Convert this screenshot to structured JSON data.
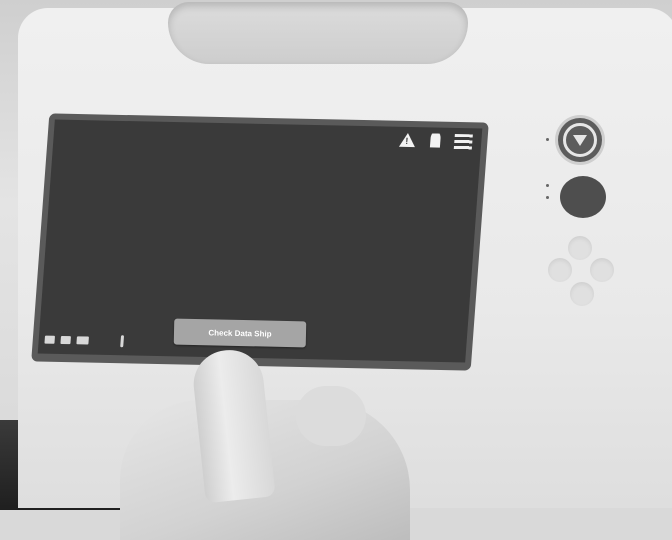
{
  "screen": {
    "title": "",
    "subtitle": "",
    "prompt": "",
    "columns": [],
    "row": {
      "col1": "",
      "col2": "",
      "col3": ""
    },
    "icons": {
      "warning": "warning-icon",
      "user": "user-icon",
      "menu": "menu-icon"
    },
    "action_button_label": "Check Data Ship",
    "below_button_text": ""
  },
  "colors": {
    "screen_bg": "#3a3a3a",
    "button_bg": "#a5a5a5",
    "device_body": "#ececec"
  }
}
